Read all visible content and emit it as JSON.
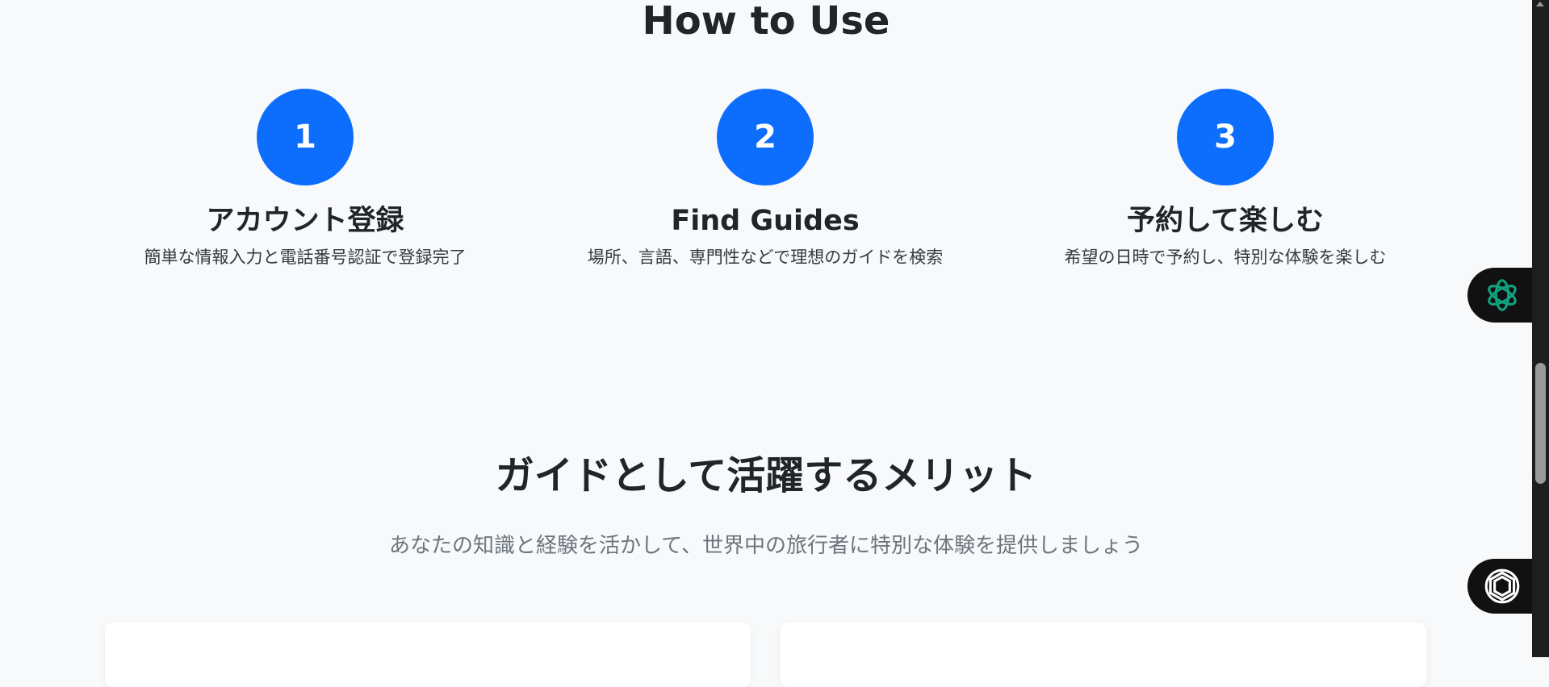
{
  "how_to_use": {
    "title": "How to Use",
    "steps": [
      {
        "number": "1",
        "title": "アカウント登録",
        "desc": "簡単な情報入力と電話番号認証で登録完了"
      },
      {
        "number": "2",
        "title": "Find Guides",
        "desc": "場所、言語、専門性などで理想のガイドを検索"
      },
      {
        "number": "3",
        "title": "予約して楽しむ",
        "desc": "希望の日時で予約し、特別な体験を楽しむ"
      }
    ]
  },
  "merits": {
    "title": "ガイドとして活躍するメリット",
    "subtitle": "あなたの知識と経験を活かして、世界中の旅行者に特別な体験を提供しましょう"
  },
  "floating_buttons": {
    "top_icon": "chatgpt-flower-icon",
    "bottom_icon": "assistant-knot-icon",
    "top_icon_color": "#10a37f"
  },
  "colors": {
    "accent": "#0d6efd",
    "background": "#f8f9fa"
  }
}
